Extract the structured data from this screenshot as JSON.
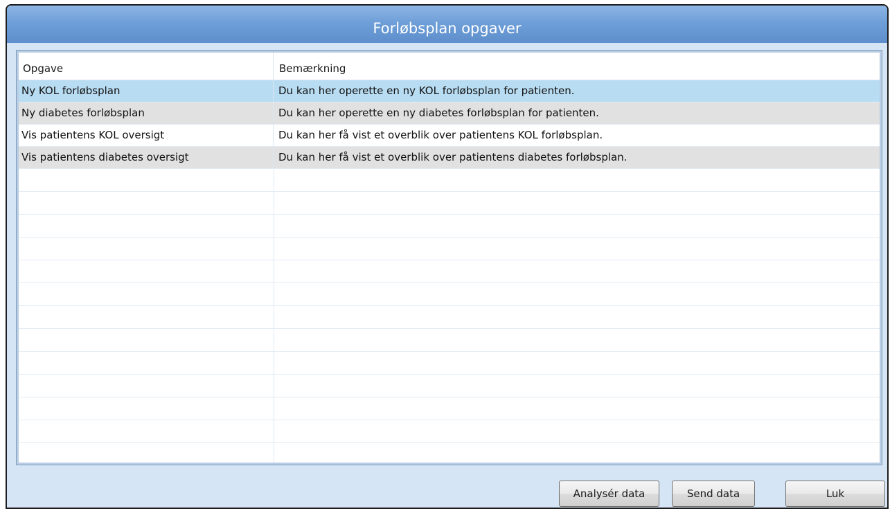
{
  "window": {
    "title": "Forløbsplan opgaver"
  },
  "grid": {
    "columns": [
      "Opgave",
      "Bemærkning"
    ],
    "rows": [
      {
        "task": "Ny KOL forløbsplan",
        "note": "Du kan her operette en ny KOL forløbsplan for patienten."
      },
      {
        "task": "Ny diabetes forløbsplan",
        "note": "Du kan her operette en ny diabetes forløbsplan for patienten."
      },
      {
        "task": "Vis patientens KOL oversigt",
        "note": "Du kan her få vist et overblik over patientens KOL forløbsplan."
      },
      {
        "task": "Vis patientens diabetes oversigt",
        "note": "Du kan her få vist et overblik over patientens diabetes forløbsplan."
      }
    ],
    "selected_row": 0
  },
  "buttons": {
    "analyse": "Analysér data",
    "send": "Send data",
    "close": "Luk"
  },
  "colors": {
    "title_bar": "#6f9fd8",
    "window_bg": "#d6e5f6",
    "selected_row": "#b8dcf2",
    "alt_row": "#e1e1e1"
  }
}
